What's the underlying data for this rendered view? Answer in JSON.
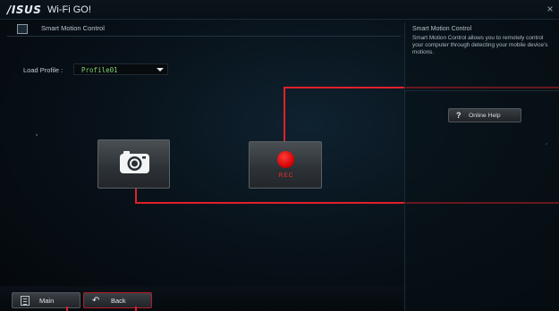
{
  "window": {
    "brand": "/ISUS",
    "title": "Wi-Fi GO!",
    "close_label": "×"
  },
  "header": {
    "title": "Smart Motion Control",
    "icon": "document-icon"
  },
  "profile": {
    "label": "Load Profile :",
    "selected": "Profile01"
  },
  "controls": {
    "camera_icon": "camera-icon",
    "rec_label": "REC"
  },
  "side_panel": {
    "title": "Smart Motion Control",
    "description": "Smart Motion Control allows you to remotely control your computer through detecting your mobile device's motions.",
    "help_icon": "?",
    "help_label": "Online Help"
  },
  "footer": {
    "main_label": "Main",
    "back_label": "Back",
    "back_icon": "↶"
  },
  "colors": {
    "accent_red": "#e0202a",
    "profile_green": "#7fd36e",
    "background": "#08121a"
  }
}
